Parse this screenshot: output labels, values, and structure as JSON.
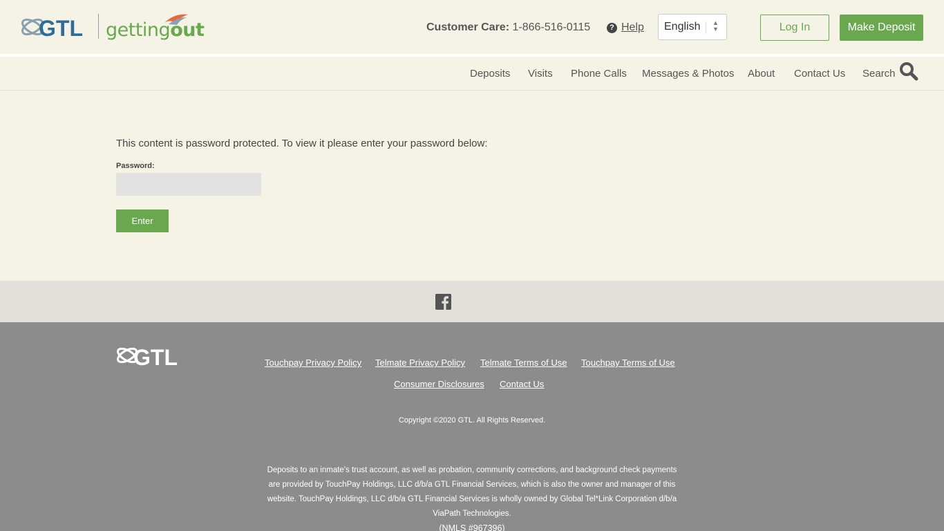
{
  "brand": {
    "gtl_logo_text": "GTL",
    "gettingout_prefix": "getting",
    "gettingout_suffix": "out"
  },
  "header": {
    "care_label": "Customer Care:",
    "care_phone": "1-866-516-0115",
    "help_label": "Help",
    "language": "English",
    "login_label": "Log In",
    "deposit_label": "Make Deposit"
  },
  "nav": {
    "items": [
      "Deposits",
      "Visits",
      "Phone Calls",
      "Messages & Photos",
      "About",
      "Contact Us",
      "Search"
    ]
  },
  "main": {
    "message": "This content is password protected. To view it please enter your password below:",
    "password_label": "Password:",
    "password_value": "",
    "enter_label": "Enter"
  },
  "footer": {
    "links": [
      "Touchpay Privacy Policy",
      "Telmate Privacy Policy",
      "Telmate Terms of Use",
      "Touchpay Terms of Use",
      "Consumer Disclosures",
      "Contact Us"
    ],
    "copyright": "Copyright ©2020 GTL. All Rights Reserved.",
    "disclaimer": "Deposits to an inmate's trust account, as well as probation, community corrections, and background check payments are provided by TouchPay Holdings, LLC d/b/a GTL Financial Services, which is also the owner and manager of this website. TouchPay Holdings, LLC d/b/a GTL Financial Services is wholly owned by Global Tel*Link Corporation d/b/a ViaPath Technologies.",
    "nmls": "(NMLS #967396)"
  },
  "colors": {
    "accent_green": "#6aa84f",
    "background": "#f5f2e6",
    "footer_gray": "#8c8c8c",
    "social_strip": "#e3e0da"
  },
  "icons": [
    "gtl-logo",
    "gettingout-logo",
    "help-icon",
    "select-arrows-icon",
    "search-icon",
    "facebook-icon"
  ]
}
